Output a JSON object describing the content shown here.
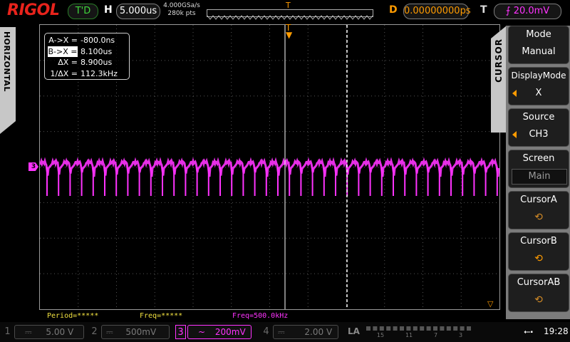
{
  "top": {
    "brand": "RIGOL",
    "run_status": "T'D",
    "h_label": "H",
    "timebase": "5.000us",
    "sample_rate": "4.000GSa/s",
    "memory_depth": "280k pts",
    "d_label": "D",
    "delay": "0.00000000ps",
    "t_label": "T",
    "trigger_level": "20.0mV",
    "trigger_icon": "rising-edge-icon"
  },
  "left_tab": {
    "label": "HORIZONTAL"
  },
  "cursor_readout": {
    "ax_label": "A->X =",
    "ax_value": "-800.0ns",
    "bx_label": "B->X =",
    "bx_value": "8.100us",
    "dx_label": "ΔX =",
    "dx_value": "8.900us",
    "inv_label": "1/ΔX =",
    "inv_value": "112.3kHz"
  },
  "channel_marker": "3",
  "measurements": {
    "period": "Period=*****",
    "freq": "Freq=*****",
    "freq_ch3": "Freq=500.0kHz"
  },
  "menu": {
    "tab_label": "CURSOR",
    "mode_title": "Mode",
    "mode_value": "Manual",
    "display_title": "DisplayMode",
    "display_value": "X",
    "source_title": "Source",
    "source_value": "CH3",
    "screen_title": "Screen",
    "screen_value": "Main",
    "cursor_a": "CursorA",
    "cursor_b": "CursorB",
    "cursor_ab": "CursorAB",
    "knob_glyph": "⟲"
  },
  "bottom": {
    "ch1_num": "1",
    "ch1_scale": "5.00 V",
    "ch2_num": "2",
    "ch2_scale": "500mV",
    "ch3_num": "3",
    "ch3_scale": "200mV",
    "ch4_num": "4",
    "ch4_scale": "2.00 V",
    "la_label": "LA",
    "la_ticks": [
      "15",
      "11",
      "7",
      "3"
    ],
    "usb_icon": "usb-icon",
    "time": "19:28"
  },
  "colors": {
    "ch3": "#ff33ff",
    "trigger": "#ff9b00",
    "status": "#40d83c",
    "brand": "#e8231c"
  }
}
